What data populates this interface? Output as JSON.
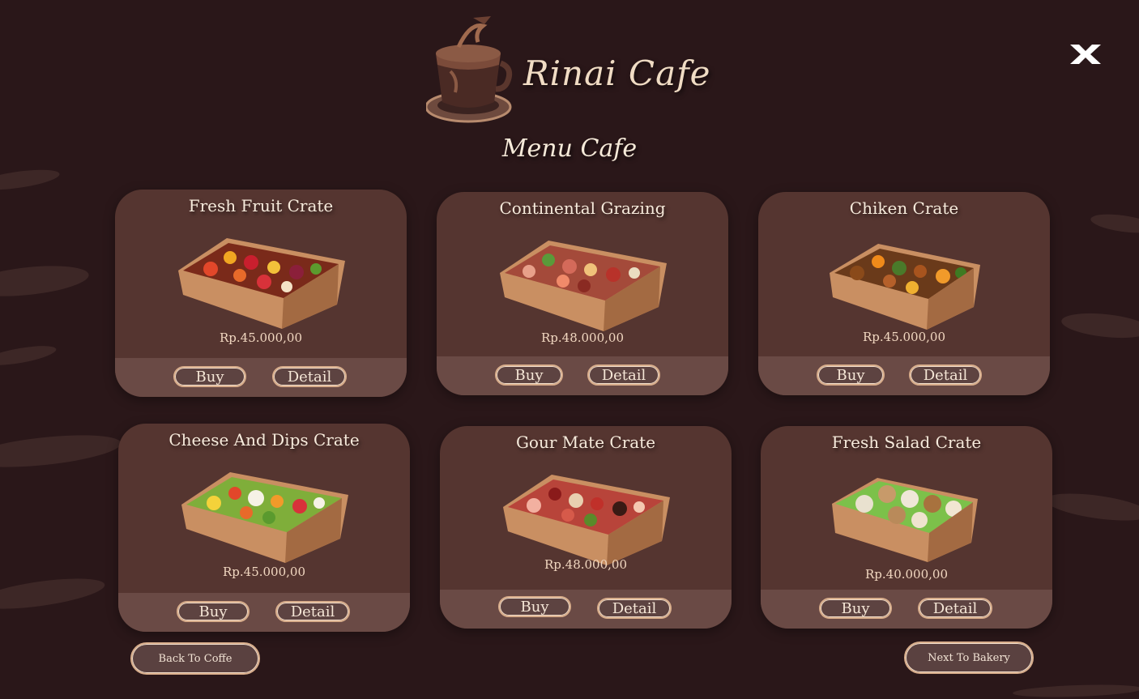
{
  "header": {
    "brand": "Rinai Cafe",
    "menu_title": "Menu Cafe"
  },
  "colors": {
    "background": "#2a1719",
    "card": "#553530",
    "card_footer": "#6a4a45",
    "button_border": "#d9ae8c"
  },
  "icons": {
    "logo": "coffee-cup-logo-icon",
    "close": "close-x-icon"
  },
  "products": [
    {
      "name": "Fresh Fruit Crate",
      "price": "Rp.45.000,00",
      "buy_label": "Buy",
      "detail_label": "Detail",
      "image": "fruit-crate-image"
    },
    {
      "name": "Continental Grazing",
      "price": "Rp.48.000,00",
      "buy_label": "Buy",
      "detail_label": "Detail",
      "image": "grazing-crate-image"
    },
    {
      "name": "Chiken Crate",
      "price": "Rp.45.000,00",
      "buy_label": "Buy",
      "detail_label": "Detail",
      "image": "chicken-crate-image"
    },
    {
      "name": "Cheese And Dips Crate",
      "price": "Rp.45.000,00",
      "buy_label": "Buy",
      "detail_label": "Detail",
      "image": "cheese-dips-crate-image"
    },
    {
      "name": "Gour Mate Crate",
      "price": "Rp.48.000,00",
      "buy_label": "Buy",
      "detail_label": "Detail",
      "image": "gourmet-crate-image"
    },
    {
      "name": "Fresh Salad Crate",
      "price": "Rp.40.000,00",
      "buy_label": "Buy",
      "detail_label": "Detail",
      "image": "salad-crate-image"
    }
  ],
  "nav": {
    "back_label": "Back To Coffe",
    "next_label": "Next To Bakery"
  }
}
